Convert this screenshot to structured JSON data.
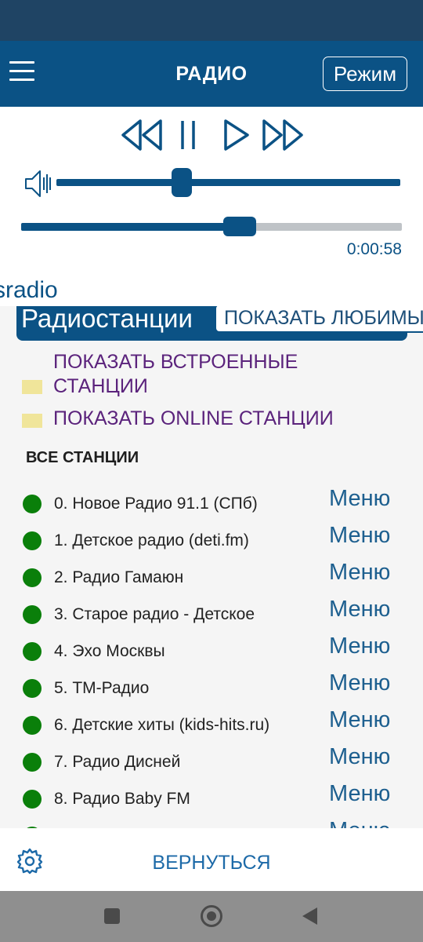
{
  "app": {
    "title": "РАДИО",
    "mode_label": "Режим"
  },
  "player": {
    "time": "0:00:58",
    "volume_level": 0.36,
    "progress": 0.56,
    "current_source": "sradio"
  },
  "stations_panel": {
    "tab_label": "Радиостанции",
    "favorites_button": "ПОКАЗАТЬ ЛЮБИМЫЕ",
    "filters": [
      {
        "lines": [
          "ПОКАЗАТЬ ВСТРОЕННЫЕ",
          "СТАНЦИИ"
        ]
      },
      {
        "lines": [
          "ПОКАЗАТЬ ONLINE СТАНЦИИ"
        ]
      }
    ],
    "list_heading": "ВСЕ СТАНЦИИ",
    "menu_label": "Меню",
    "stations": [
      "0. Новое Радио 91.1 (СПб)",
      "1. Детское радио (deti.fm)",
      "2. Радио Гамаюн",
      "3. Старое радио - Детское",
      "4. Эхо Москвы",
      "5. ТМ-Радио",
      "6. Детские хиты (kids-hits.ru)",
      "7. Радио Дисней",
      "8. Радио Baby FM"
    ],
    "status_color": "#0a7f0a"
  },
  "footer": {
    "back_label": "ВЕРНУТЬСЯ"
  },
  "colors": {
    "primary": "#0b5285",
    "status_bar": "#1f4464",
    "filter_text": "#5b237c",
    "checkbox": "#f0e59a"
  }
}
